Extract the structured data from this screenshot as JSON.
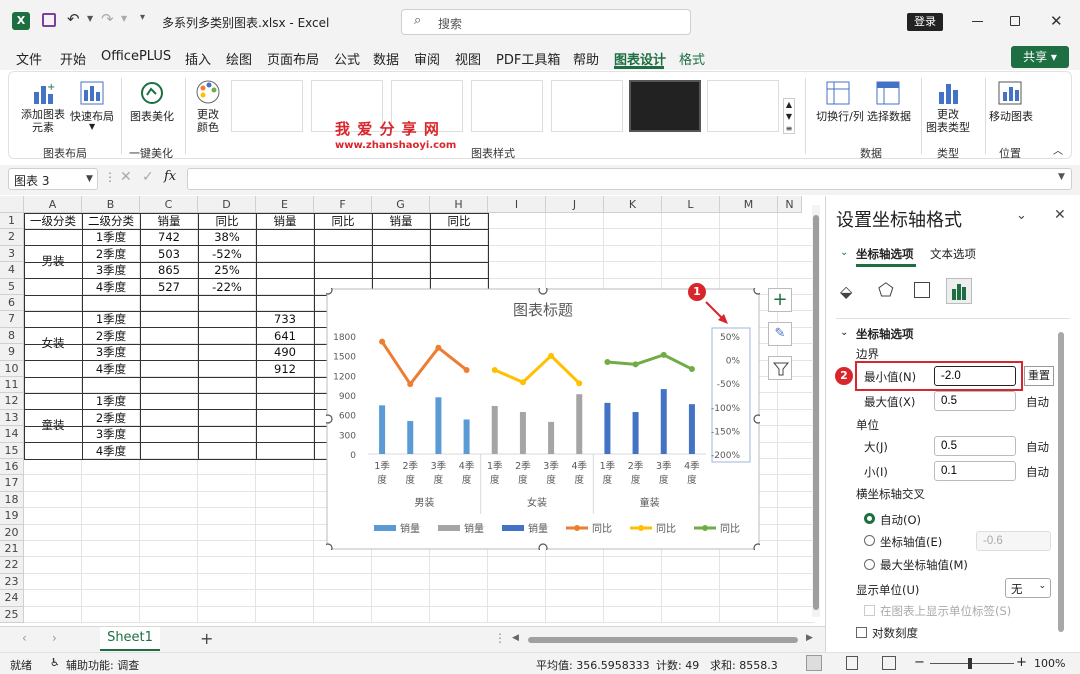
{
  "window": {
    "title": "多系列多类别图表.xlsx - Excel",
    "search_placeholder": "搜索",
    "login": "登录",
    "share": "共享"
  },
  "menu": [
    "文件",
    "开始",
    "OfficePLUS",
    "插入",
    "绘图",
    "页面布局",
    "公式",
    "数据",
    "审阅",
    "视图",
    "PDF工具箱",
    "帮助",
    "图表设计",
    "格式"
  ],
  "ribbon": {
    "add_element": "添加图表\n元素",
    "quick_layout": "快速布局",
    "beautify": "图表美化",
    "change_colors": "更改\n颜色",
    "switch_rowcol": "切换行/列",
    "select_data": "选择数据",
    "change_type": "更改\n图表类型",
    "move_chart": "移动图表",
    "groups": {
      "layout": "图表布局",
      "beautify": "一键美化",
      "styles": "图表样式",
      "data": "数据",
      "type": "类型",
      "location": "位置"
    },
    "watermark": "我 爱 分 享 网",
    "watermark_url": "www.zhanshaoyi.com"
  },
  "formula_bar": {
    "name_box": "图表 3",
    "fx": "fx",
    "value": ""
  },
  "columns": [
    "A",
    "B",
    "C",
    "D",
    "E",
    "F",
    "G",
    "H",
    "I",
    "J",
    "K",
    "L",
    "M",
    "N"
  ],
  "rows": [
    "1",
    "2",
    "3",
    "4",
    "5",
    "6",
    "7",
    "8",
    "9",
    "10",
    "11",
    "12",
    "13",
    "14",
    "15",
    "16",
    "17",
    "18",
    "19",
    "20",
    "21",
    "22",
    "23",
    "24",
    "25"
  ],
  "header_row": [
    "一级分类",
    "二级分类",
    "销量",
    "同比",
    "销量",
    "同比",
    "销量",
    "同比"
  ],
  "groups": [
    {
      "name": "男装",
      "quarters": [
        "1季度",
        "2季度",
        "3季度",
        "4季度"
      ],
      "sales": [
        "742",
        "503",
        "865",
        "527"
      ],
      "yoy": [
        "38%",
        "-52%",
        "25%",
        "-22%"
      ]
    },
    {
      "name": "女装",
      "quarters": [
        "1季度",
        "2季度",
        "3季度",
        "4季度"
      ],
      "sales": [
        "733",
        "641",
        "490",
        "912"
      ]
    },
    {
      "name": "童装",
      "quarters": [
        "1季度",
        "2季度",
        "3季度",
        "4季度"
      ]
    }
  ],
  "chart_data": {
    "type": "bar",
    "title": "图表标题",
    "groups": [
      "男装",
      "女装",
      "童装"
    ],
    "categories": [
      "1季度",
      "2季度",
      "3季度",
      "4季度"
    ],
    "y_left": {
      "min": 0,
      "max": 1800,
      "ticks": [
        "1800",
        "1500",
        "1200",
        "900",
        "600",
        "300",
        "0"
      ]
    },
    "y_right": {
      "min": -2.0,
      "max": 0.5,
      "ticks": [
        "50%",
        "0%",
        "-50%",
        "-100%",
        "-150%",
        "-200%"
      ]
    },
    "series": [
      {
        "name": "销量",
        "kind": "bar",
        "group": 0,
        "color": "#5b9bd5",
        "values": [
          742,
          503,
          865,
          527
        ]
      },
      {
        "name": "销量",
        "kind": "bar",
        "group": 1,
        "color": "#a5a5a5",
        "values": [
          733,
          641,
          490,
          912
        ]
      },
      {
        "name": "销量",
        "kind": "bar",
        "group": 2,
        "color": "#4472c4",
        "values": [
          780,
          640,
          990,
          760
        ]
      },
      {
        "name": "同比",
        "kind": "line",
        "group": 0,
        "color": "#ed7d31",
        "values": [
          0.38,
          -0.52,
          0.25,
          -0.22
        ]
      },
      {
        "name": "同比",
        "kind": "line",
        "group": 1,
        "color": "#ffc000",
        "values": [
          -0.22,
          -0.48,
          0.08,
          -0.5
        ]
      },
      {
        "name": "同比",
        "kind": "line",
        "group": 2,
        "color": "#70ad47",
        "values": [
          -0.05,
          -0.1,
          0.1,
          -0.2
        ]
      }
    ]
  },
  "chart_tools": [
    "+",
    "brush",
    "filter"
  ],
  "pane": {
    "title": "设置坐标轴格式",
    "tab_axis": "坐标轴选项",
    "tab_text": "文本选项",
    "section": "坐标轴选项",
    "bounds": "边界",
    "min_label": "最小值(N)",
    "min_value": "-2.0",
    "reset": "重置",
    "max_label": "最大值(X)",
    "max_value": "0.5",
    "auto": "自动",
    "units": "单位",
    "major_label": "大(J)",
    "major_value": "0.5",
    "minor_label": "小(I)",
    "minor_value": "0.1",
    "cross_title": "横坐标轴交叉",
    "cross_auto": "自动(O)",
    "cross_value_label": "坐标轴值(E)",
    "cross_value": "-0.6",
    "cross_max": "最大坐标轴值(M)",
    "display_units": "显示单位(U)",
    "display_units_value": "无",
    "show_units": "在图表上显示单位标签(S)",
    "log_scale": "对数刻度"
  },
  "sheet_tab": "Sheet1",
  "status": {
    "ready": "就绪",
    "accessibility": "辅助功能: 调查",
    "average": "平均值: 356.5958333",
    "count": "计数: 49",
    "sum": "求和: 8558.3",
    "zoom": "100%"
  },
  "markers": [
    "1",
    "2"
  ]
}
